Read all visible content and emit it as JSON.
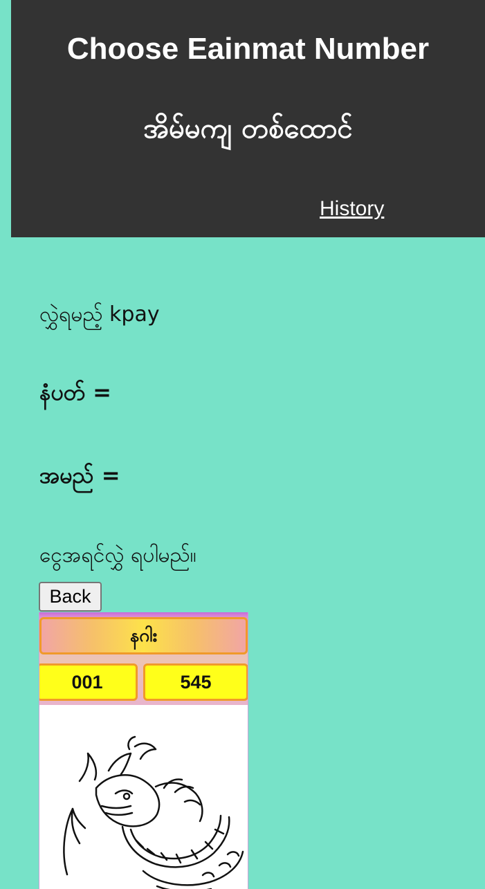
{
  "header": {
    "title_en": "Choose Eainmat Number",
    "title_mm": "အိမ်မကျ တစ်ထောင်",
    "history_label": "History"
  },
  "payment": {
    "transfer_text": "လွှဲရမည့် kpay",
    "phone_label": "နံပတ် =",
    "name_label": "အမည် =",
    "note_text": "ငွေအရင်လွှဲ ရပါမည်။"
  },
  "back_label": "Back",
  "card": {
    "title": "နဂါး",
    "numbers": [
      "001",
      "545"
    ],
    "image_icon": "dragon-illustration"
  }
}
